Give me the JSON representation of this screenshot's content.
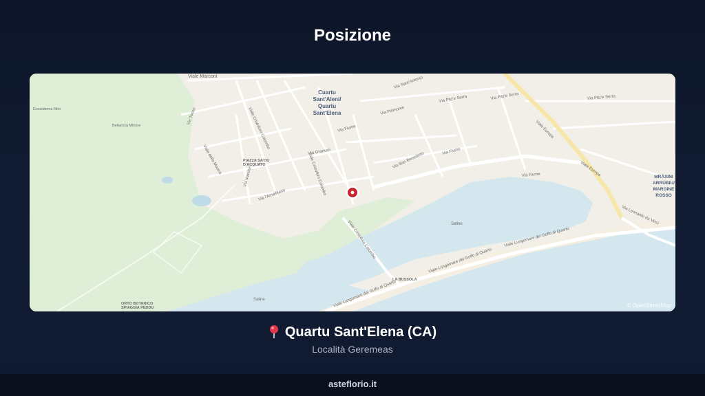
{
  "header": {
    "title": "Posizione"
  },
  "map": {
    "attribution": "© OpenStreetMap",
    "labels": {
      "marconi": "Viale Marconi",
      "city": [
        "Cuartu",
        "Sant'Aleni/",
        "Quartu",
        "Sant'Elena"
      ],
      "mraxini": [
        "MRÀXINI",
        "ARRÙBIU/",
        "MARGINE",
        "ROSSO"
      ],
      "sant_antonio": "Via Sant'Antonio",
      "pitz_serra_1": "Via Pitz'e Serra",
      "pitz_serra_2": "Via Pitz'e Serra",
      "pitz_serra_3": "Via Pitz'e Serra",
      "piemonte": "Via Piemonte",
      "fiume_1": "Via Fiume",
      "fiume_2": "Via Fiume",
      "fiume_3": "Via Fiume",
      "san_benedetto": "Via San Benedetto",
      "europa_1": "Viale Europa",
      "europa_2": "Viale Europa",
      "leonardo": "Via Leonardo da Vinci",
      "colombo_1": "Viale Cristoforo Colombo",
      "colombo_2": "Viale Cristoforo Colombo",
      "colombo_3": "Viale Cristoforo Colombo",
      "longomare_1": "Viale Lungomare del Golfo di Quartu",
      "longomare_2": "Viale Lungomare del Golfo di Quartu",
      "longomare_3": "Viale Lungomare del Golfo di Quartu",
      "saline_1": "Saline",
      "saline_2": "Saline",
      "piazza": [
        "PIAZZA SA'OU",
        "D'ACQUATO"
      ],
      "orto": [
        "ORTO BOTANICO",
        "SPIAGGIA PEDDU"
      ],
      "bussola": "LA BUSSOLA",
      "ecosistema": "Ecosistema filtro",
      "bellarosa": "Bellarosa Minore",
      "torino": "Via Torino",
      "amalfi": "Via l'Amalfitano",
      "marche": "Via Marche",
      "della_musica": "Viale della Musica",
      "gramsci": "Via Gramsci"
    },
    "marker": {
      "name": "location-marker",
      "color": "#c0262d"
    }
  },
  "location": {
    "pin_glyph": "📍",
    "name": "Quartu Sant'Elena (CA)",
    "locality": "Località Geremeas"
  },
  "footer": {
    "site": "asteflorio.it"
  }
}
